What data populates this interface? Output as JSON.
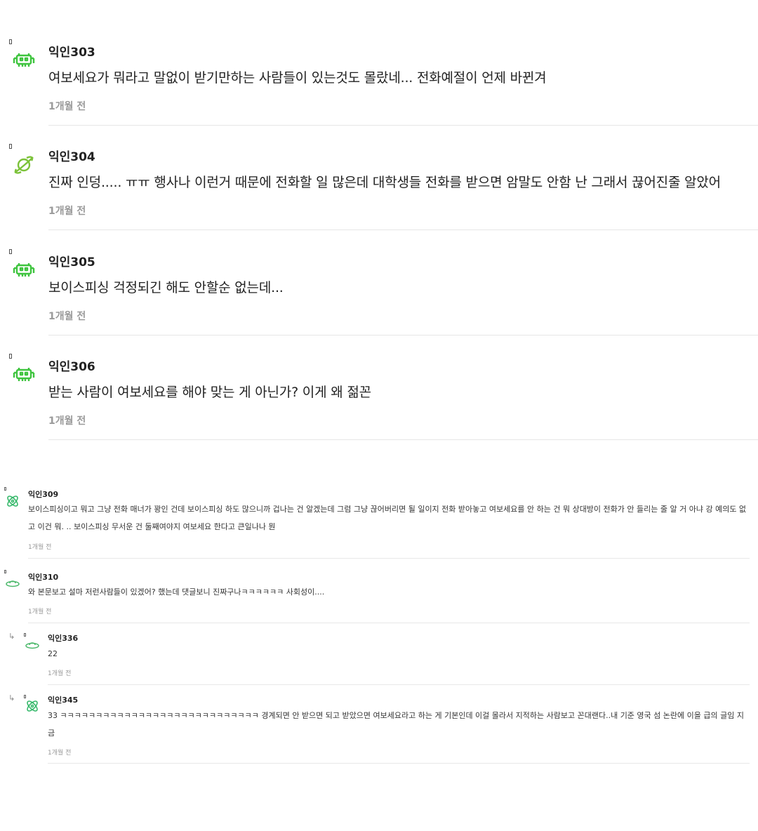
{
  "comments_large": [
    {
      "author": "익인303",
      "text": "여보세요가 뭐라고 말없이 받기만하는 사람들이 있는것도 몰랐네... 전화예절이 언제 바뀐겨",
      "time": "1개월 전",
      "avatar": "space-invader-icon"
    },
    {
      "author": "익인304",
      "text": "진짜 인덩..... ㅠㅠ 행사나 이런거 때문에 전화할 일 많은데 대학생들 전화를 받으면 암말도 안함 난 그래서 끊어진줄 알았어",
      "time": "1개월 전",
      "avatar": "planet-icon"
    },
    {
      "author": "익인305",
      "text": "보이스피싱 걱정되긴 해도 안할순 없는데...",
      "time": "1개월 전",
      "avatar": "space-invader-icon"
    },
    {
      "author": "익인306",
      "text": "받는 사람이 여보세요를 해야 맞는 게 아닌가? 이게 왜 젊꼰",
      "time": "1개월 전",
      "avatar": "space-invader-icon"
    }
  ],
  "comments_small": [
    {
      "author": "익인309",
      "text": "보이스피싱이고 뭐고 그냥 전화 매너가 꽝인 건데 보이스피싱 하도 많으니까 겁나는 건 알겠는데 그럼 그냥 끊어버리면 될 일이지 전화 받아놓고 여보세요를 안 하는 건 뭐 상대방이 전화가 안 들리는 줄 알 거 아냐 강 예의도 없고 이건 뭐. .. 보이스피싱 무서운 건 둘째여야지 여보세요 한다고 큰일나나 뭔",
      "time": "1개월 전",
      "avatar": "atom-icon",
      "reply": false
    },
    {
      "author": "익인310",
      "text": "와 본문보고 설마 저런사람들이 있겠어? 했는데 댓글보니 진짜구나ㅋㅋㅋㅋㅋㅋ 사회성이....",
      "time": "1개월 전",
      "avatar": "ufo-icon",
      "reply": false
    },
    {
      "author": "익인336",
      "text": "22",
      "time": "1개월 전",
      "avatar": "ufo-icon",
      "reply": true
    },
    {
      "author": "익인345",
      "text": "33 ㅋㅋㅋㅋㅋㅋㅋㅋㅋㅋㅋㅋㅋㅋㅋㅋㅋㅋㅋㅋㅋㅋㅋㅋㅋㅋㅋㅋ 경계되면 안 받으면 되고 받았으면 여보세요라고 하는 게 기본인데 이걸 몰라서 지적하는 사람보고 꼰대랜다..내 기준 영국 섬 논란에 이을 급의 글임 지금",
      "time": "1개월 전",
      "avatar": "atom-icon",
      "reply": true
    }
  ],
  "reply_arrow_glyph": "↳",
  "accent_green": "#3ec43e"
}
